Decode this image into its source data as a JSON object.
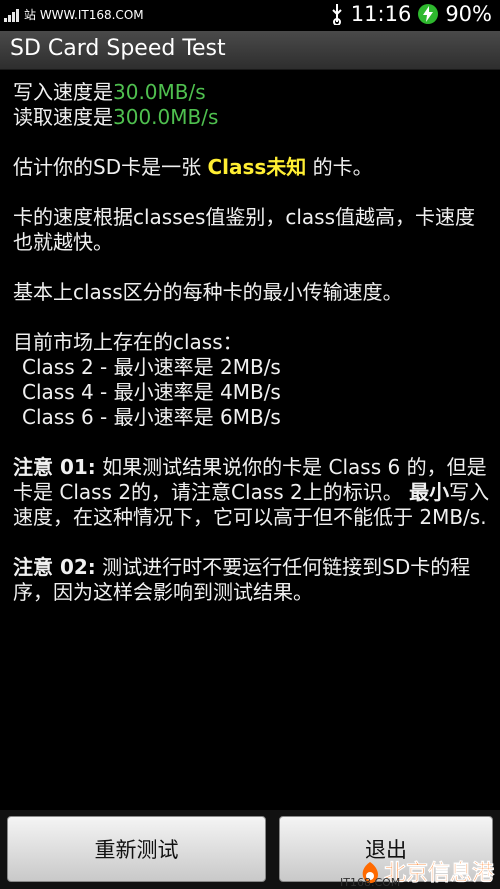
{
  "status_bar": {
    "left_text": "站 WWW.IT168.COM",
    "time": "11:16",
    "battery": "90%"
  },
  "title_bar": {
    "title": "SD Card Speed Test"
  },
  "content": {
    "write_label": "写入速度是",
    "write_value": "30.0MB/s",
    "read_label": "读取速度是",
    "read_value": "300.0MB/s",
    "estimate_prefix": "估计你的SD卡是一张 ",
    "estimate_class": "Class未知",
    "estimate_suffix": " 的卡。",
    "explain": "卡的速度根据classes值鉴别，class值越高，卡速度也就越快。",
    "basic": "基本上class区分的每种卡的最小传输速度。",
    "market_heading": "目前市场上存在的class：",
    "class_list": [
      "Class 2 - 最小速率是 2MB/s",
      "Class 4 - 最小速率是 4MB/s",
      "Class 6 - 最小速率是 6MB/s"
    ],
    "note1_label": "注意 01:",
    "note1_part1": " 如果测试结果说你的卡是 Class 6 的，但是卡是 Class 2的，请注意Class 2上的标识。 ",
    "note1_bold": "最小",
    "note1_part2": "写入速度，在这种情况下，它可以高于但不能低于 2MB/s.",
    "note2_label": "注意 02:",
    "note2_text": " 测试进行时不要运行任何链接到SD卡的程序，因为这样会影响到测试结果。"
  },
  "buttons": {
    "retest": "重新测试",
    "exit": "退出"
  },
  "watermark": {
    "brand": "北京信息港",
    "small": "IT168.COM"
  },
  "colors": {
    "value_green": "#4fc04f",
    "class_yellow": "#ffee33",
    "watermark_orange": "#ff6a00"
  }
}
